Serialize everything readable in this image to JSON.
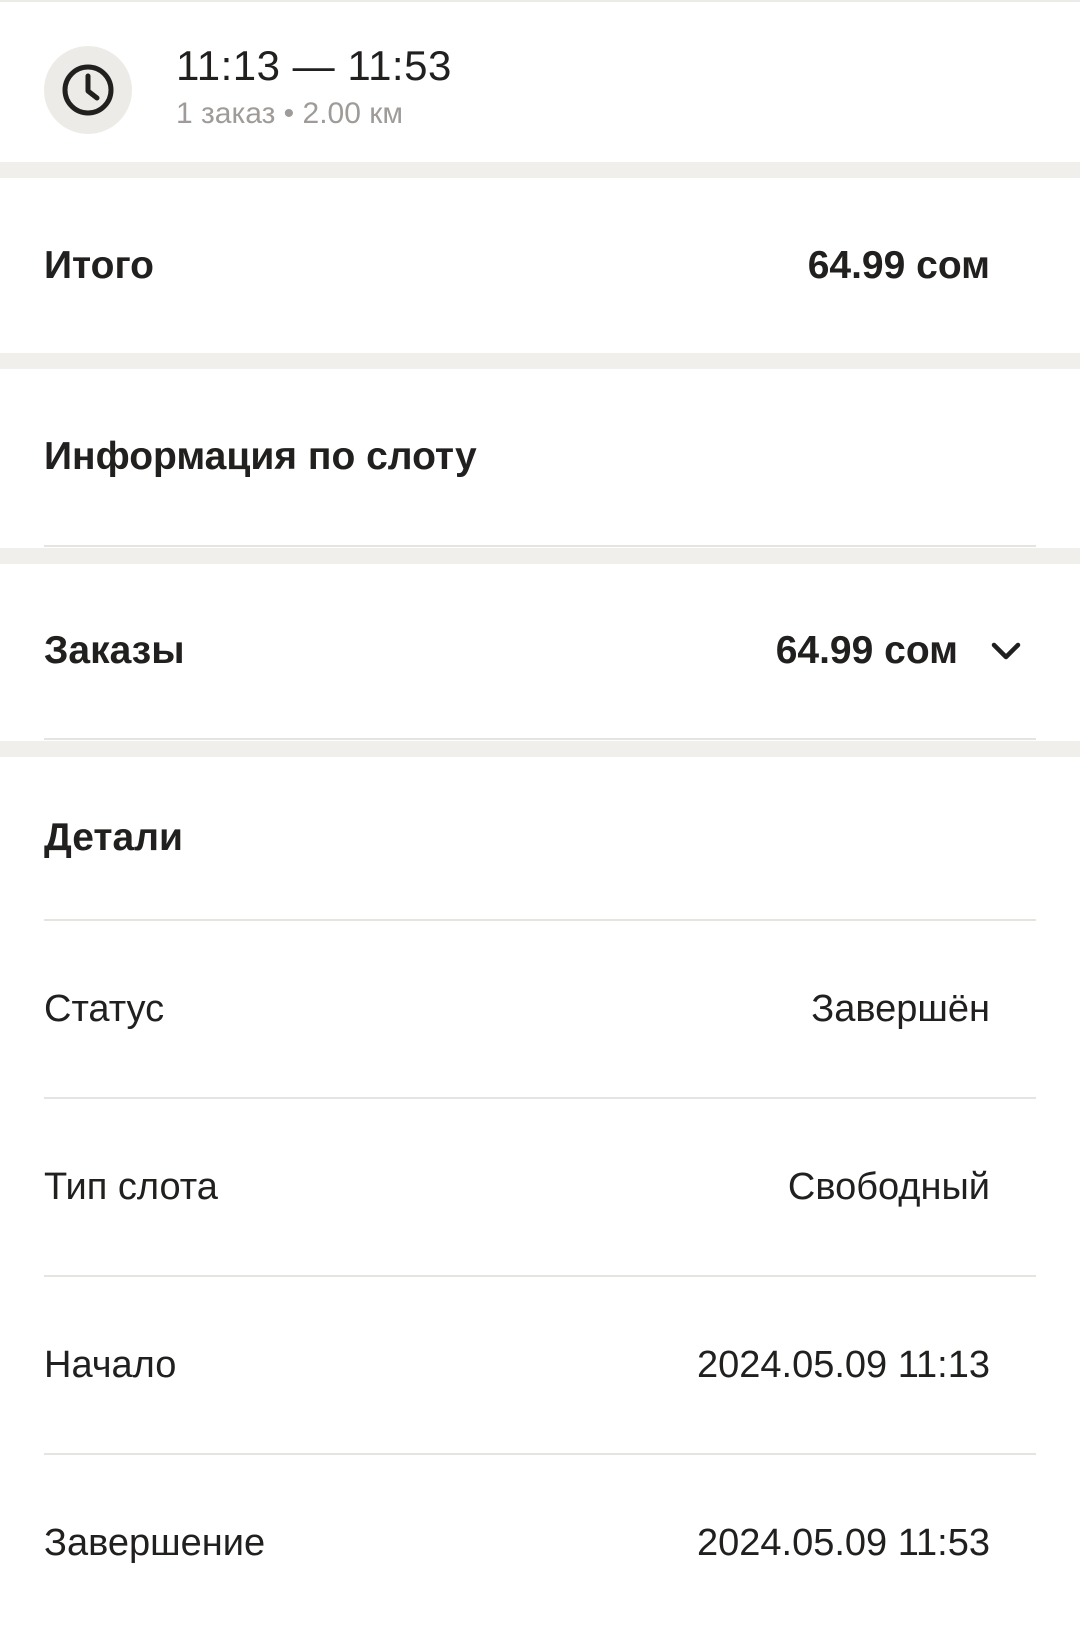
{
  "header": {
    "time_range": "11:13 — 11:53",
    "summary": "1 заказ • 2.00 км",
    "icon": "clock-icon"
  },
  "total": {
    "label": "Итого",
    "value": "64.99 сом"
  },
  "slot_info": {
    "label": "Информация по слоту"
  },
  "orders": {
    "label": "Заказы",
    "value": "64.99 сом",
    "icon": "chevron-down-icon"
  },
  "details": {
    "title": "Детали",
    "rows": [
      {
        "label": "Статус",
        "value": "Завершён"
      },
      {
        "label": "Тип слота",
        "value": "Свободный"
      },
      {
        "label": "Начало",
        "value": "2024.05.09 11:13"
      },
      {
        "label": "Завершение",
        "value": "2024.05.09 11:53"
      }
    ]
  },
  "colors": {
    "text": "#21201f",
    "secondary_text": "#9e9b98",
    "separator": "#f0efeb",
    "icon_bg": "#ecebe7"
  }
}
